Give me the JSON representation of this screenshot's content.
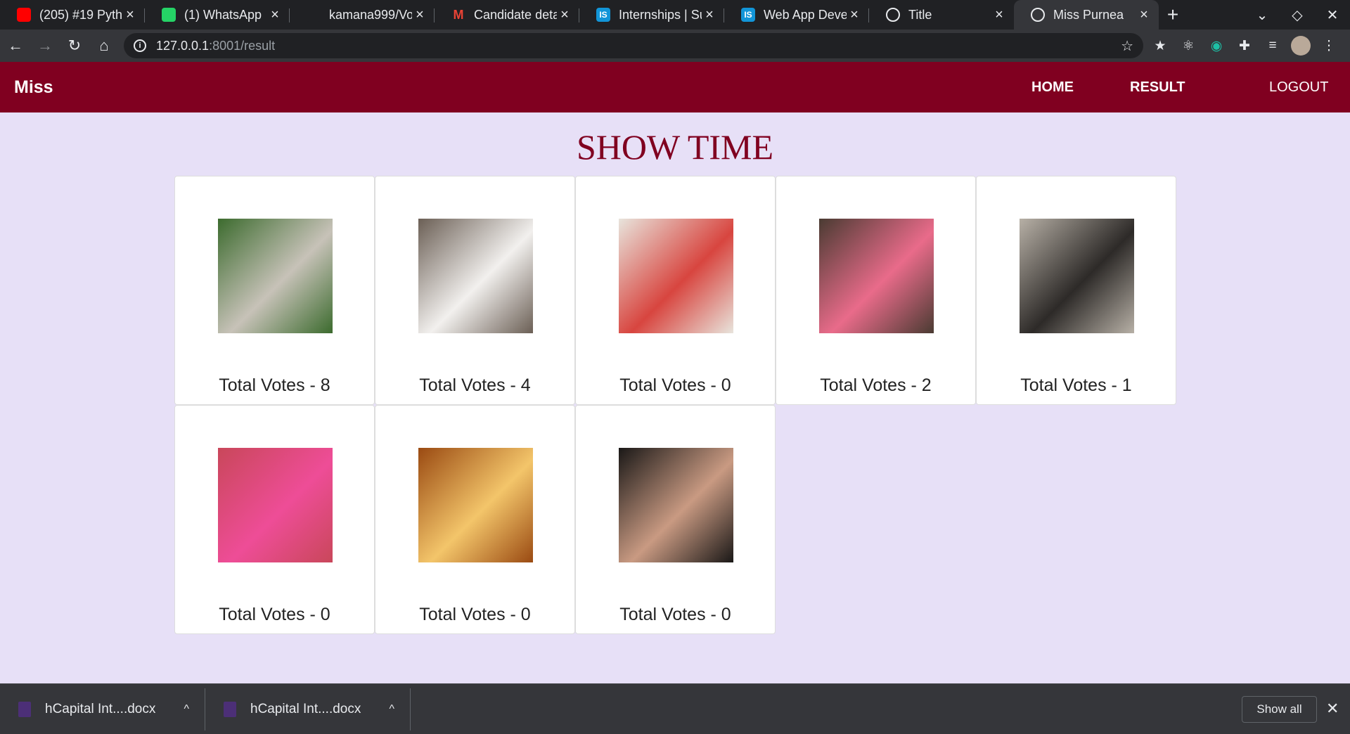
{
  "browser": {
    "tabs": [
      {
        "title": "(205) #19 Pyth",
        "icon": "youtube-icon",
        "color": "#ff0000"
      },
      {
        "title": "(1) WhatsApp",
        "icon": "whatsapp-icon",
        "color": "#25d366"
      },
      {
        "title": "kamana999/Vo",
        "icon": "github-icon",
        "color": "#202124"
      },
      {
        "title": "Candidate deta",
        "icon": "gmail-icon",
        "color": "#ea4335"
      },
      {
        "title": "Internships | Su",
        "icon": "internshala-icon",
        "color": "#1295d8"
      },
      {
        "title": "Web App Devel",
        "icon": "internshala-icon",
        "color": "#1295d8"
      },
      {
        "title": "Title",
        "icon": "globe-icon",
        "color": "#e8eaed"
      },
      {
        "title": "Miss Purnea",
        "icon": "globe-icon",
        "color": "#e8eaed"
      }
    ],
    "url_host": "127.0.0.1",
    "url_path": ":8001/result"
  },
  "site": {
    "brand": "Miss",
    "nav": {
      "home": "HOME",
      "result": "RESULT",
      "logout": "LOGOUT"
    },
    "title": "SHOW TIME",
    "accent": "#800020",
    "background": "#e7e0f7"
  },
  "candidates": [
    {
      "votes_label": "Total Votes - 8",
      "votes": 8,
      "photo_colors": [
        "#3c6b2e",
        "#c7c2b8"
      ]
    },
    {
      "votes_label": "Total Votes - 4",
      "votes": 4,
      "photo_colors": [
        "#6b5f55",
        "#f2f0ee"
      ]
    },
    {
      "votes_label": "Total Votes - 0",
      "votes": 0,
      "photo_colors": [
        "#e8e4dc",
        "#d8453f"
      ]
    },
    {
      "votes_label": "Total Votes - 2",
      "votes": 2,
      "photo_colors": [
        "#4a3b32",
        "#e96b8a"
      ]
    },
    {
      "votes_label": "Total Votes - 1",
      "votes": 1,
      "photo_colors": [
        "#b7b0a6",
        "#2d2a28"
      ]
    },
    {
      "votes_label": "Total Votes - 0",
      "votes": 0,
      "photo_colors": [
        "#c9475a",
        "#ee4d97"
      ]
    },
    {
      "votes_label": "Total Votes - 0",
      "votes": 0,
      "photo_colors": [
        "#9a4a12",
        "#f3c56a"
      ]
    },
    {
      "votes_label": "Total Votes - 0",
      "votes": 0,
      "photo_colors": [
        "#1a1817",
        "#c99a82"
      ]
    }
  ],
  "downloads": {
    "items": [
      "hCapital Int....docx",
      "hCapital Int....docx"
    ],
    "show_all": "Show all"
  }
}
